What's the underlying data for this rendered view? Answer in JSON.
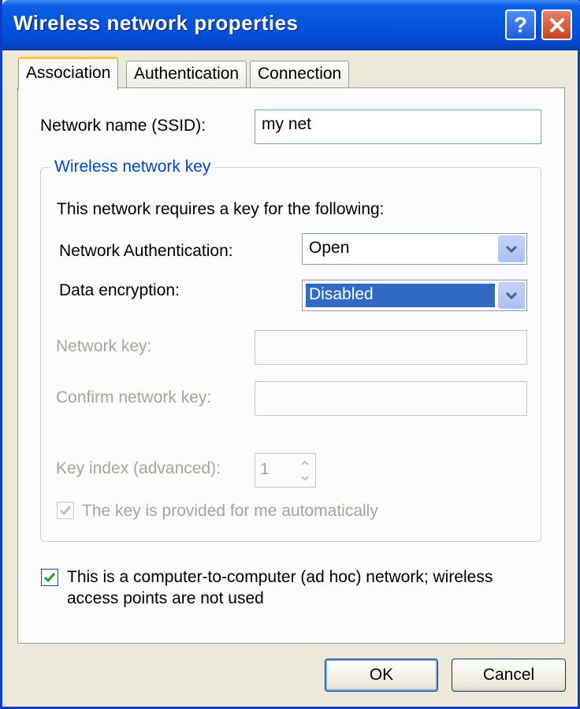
{
  "window": {
    "title": "Wireless network properties",
    "help_label": "?"
  },
  "tabs": [
    {
      "label": "Association",
      "active": true
    },
    {
      "label": "Authentication",
      "active": false
    },
    {
      "label": "Connection",
      "active": false
    }
  ],
  "ssid": {
    "label": "Network name (SSID):",
    "value": "my net"
  },
  "key_group": {
    "legend": "Wireless network key",
    "intro": "This network requires a key for the following:",
    "auth_label": "Network Authentication:",
    "auth_value": "Open",
    "encryption_label": "Data encryption:",
    "encryption_value": "Disabled",
    "network_key_label": "Network key:",
    "network_key_value": "",
    "confirm_key_label": "Confirm network key:",
    "confirm_key_value": "",
    "key_index_label": "Key index (advanced):",
    "key_index_value": "1",
    "auto_key_label": "The key is provided for me automatically",
    "auto_key_checked": true
  },
  "adhoc": {
    "label_line1": "This is a computer-to-computer (ad hoc) network; wireless",
    "label_line2": "access points are not used",
    "checked": true
  },
  "buttons": {
    "ok": "OK",
    "cancel": "Cancel"
  },
  "colors": {
    "titlebar": "#0553de",
    "group_legend": "#0046d5",
    "selection": "#316ac5",
    "checkmark": "#21a121"
  }
}
